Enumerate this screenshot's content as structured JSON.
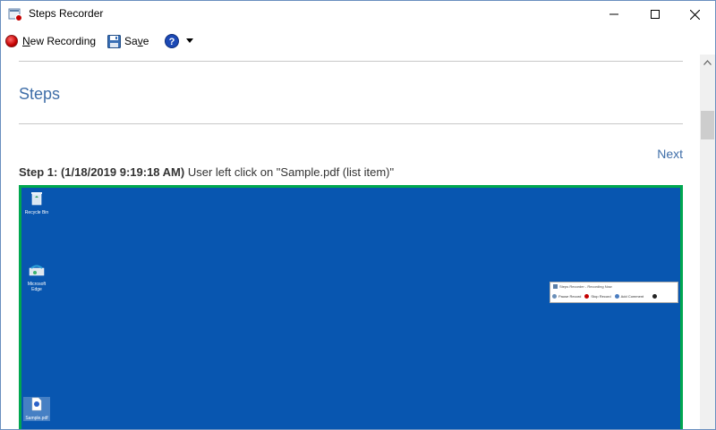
{
  "window": {
    "title": "Steps Recorder"
  },
  "toolbar": {
    "new_recording": {
      "prefix": "N",
      "rest": "ew Recording"
    },
    "save": {
      "prefix": "Sa",
      "u": "v",
      "rest": "e"
    },
    "help_icon": "question-icon",
    "dropdown_icon": "caret-down-icon"
  },
  "content": {
    "heading": "Steps",
    "next_link": "Next",
    "step": {
      "label": "Step 1: (1/18/2019 9:19:18 AM)",
      "description": " User left click on \"Sample.pdf (list item)\""
    }
  },
  "desktop_icons": [
    {
      "name": "recycle-bin-icon",
      "label": "Recycle Bin"
    },
    {
      "name": "microsoft-edge-icon",
      "label": "Microsoft Edge"
    },
    {
      "name": "pdf-file-icon",
      "label": "Sample.pdf"
    }
  ],
  "mini_recorder": {
    "title": "Steps Recorder - Recording Now",
    "pause": "Pause Record",
    "stop": "Stop Record",
    "comment": "Add Comment"
  },
  "colors": {
    "accent": "#3f6ea8",
    "desktop": "#0856b0",
    "highlight_border": "#00a74f",
    "record_red": "#c40000"
  }
}
